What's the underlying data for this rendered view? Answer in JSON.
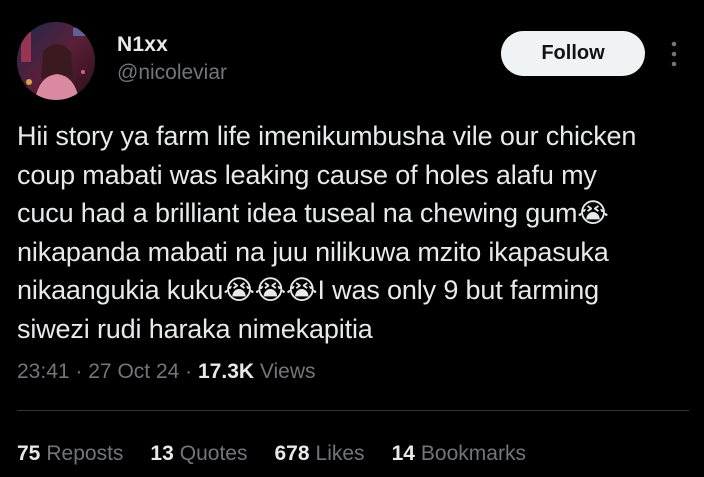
{
  "author": {
    "display_name": "N1xx",
    "handle": "@nicoleviar",
    "follow_label": "Follow"
  },
  "tweet": {
    "text": "Hii story ya farm life imenikumbusha vile our chicken\ncoup mabati was leaking cause of holes alafu my\ncucu had a brilliant idea tuseal na chewing gum😭\nnikapanda mabati na juu nilikuwa mzito ikapasuka\nnikaangukia kuku😭😭😭I was only 9 but farming\nsiwezi rudi haraka nimekapitia"
  },
  "meta": {
    "time": "23:41",
    "separator": "·",
    "date": "27 Oct 24",
    "views_count": "17.3K",
    "views_label": "Views"
  },
  "stats": {
    "reposts": {
      "count": "75",
      "label": "Reposts"
    },
    "quotes": {
      "count": "13",
      "label": "Quotes"
    },
    "likes": {
      "count": "678",
      "label": "Likes"
    },
    "bookmarks": {
      "count": "14",
      "label": "Bookmarks"
    }
  },
  "icons": {
    "more": "more-vertical-icon"
  },
  "colors": {
    "background": "#000000",
    "primary_text": "#e7e9ea",
    "secondary_text": "#71767b",
    "follow_bg": "#eff3f4",
    "divider": "#2f3336"
  }
}
